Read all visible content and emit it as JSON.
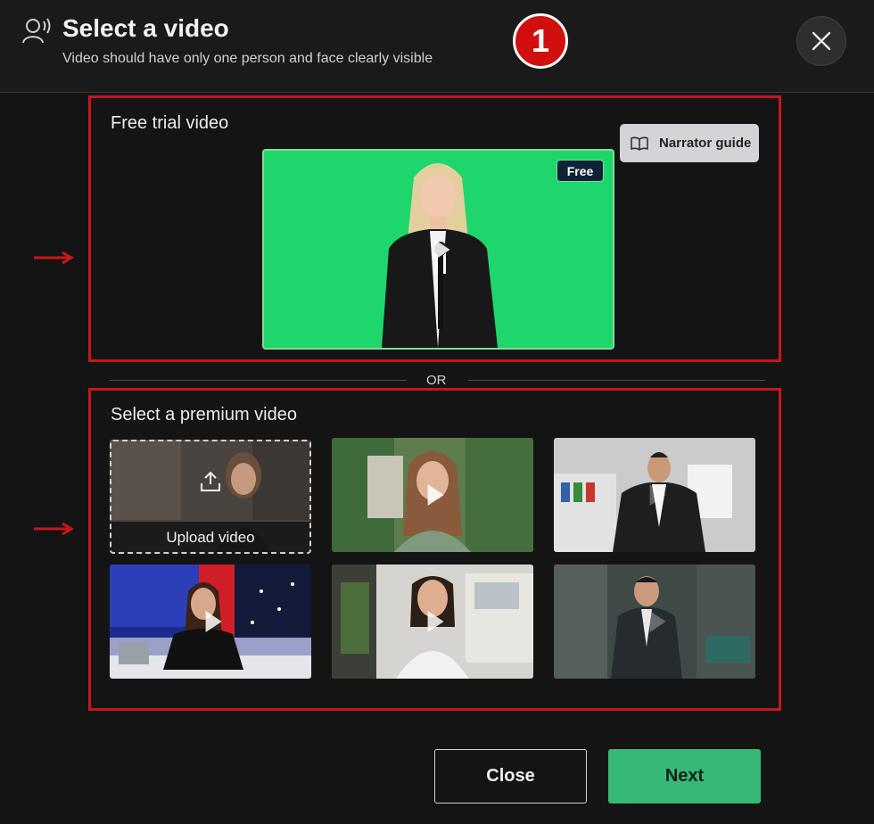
{
  "header": {
    "title": "Select a video",
    "subtitle": "Video should have only one person and face clearly visible",
    "step_number": "1",
    "icons": {
      "header": "speaking-person-icon",
      "close": "close-icon"
    }
  },
  "free_section": {
    "title": "Free trial video",
    "narrator_guide_label": "Narrator guide",
    "badge": "Free"
  },
  "divider": {
    "label": "OR"
  },
  "premium_section": {
    "title": "Select a premium video",
    "upload_label": "Upload video"
  },
  "footer": {
    "close_label": "Close",
    "next_label": "Next"
  },
  "colors": {
    "accent_green": "#36b977",
    "annotation_red": "#c8161b",
    "chroma_green": "#20d46d"
  }
}
